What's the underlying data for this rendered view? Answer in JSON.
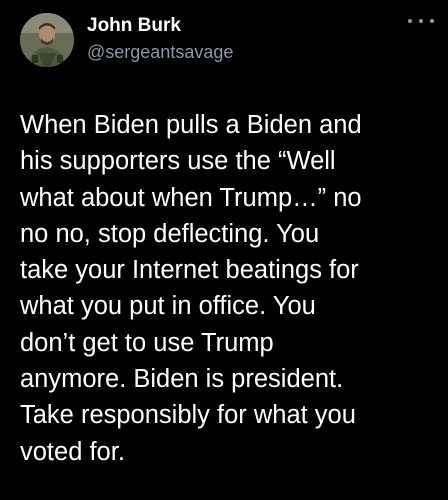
{
  "author": {
    "display_name": "John Burk",
    "handle": "@sergeantsavage",
    "avatar_icon": "profile-photo"
  },
  "more_icon": "more-options-icon",
  "tweet": {
    "text": "When Biden pulls a Biden and\nhis supporters use the “Well\nwhat about when Trump…” no\nno no, stop deflecting. You\ntake your Internet beatings for\nwhat you put in office. You\ndon’t get to use Trump\nanymore. Biden is president.\nTake responsibly for what you\nvoted for."
  },
  "colors": {
    "background": "#000000",
    "text": "#ffffff",
    "secondary_text": "#8b98a5"
  }
}
